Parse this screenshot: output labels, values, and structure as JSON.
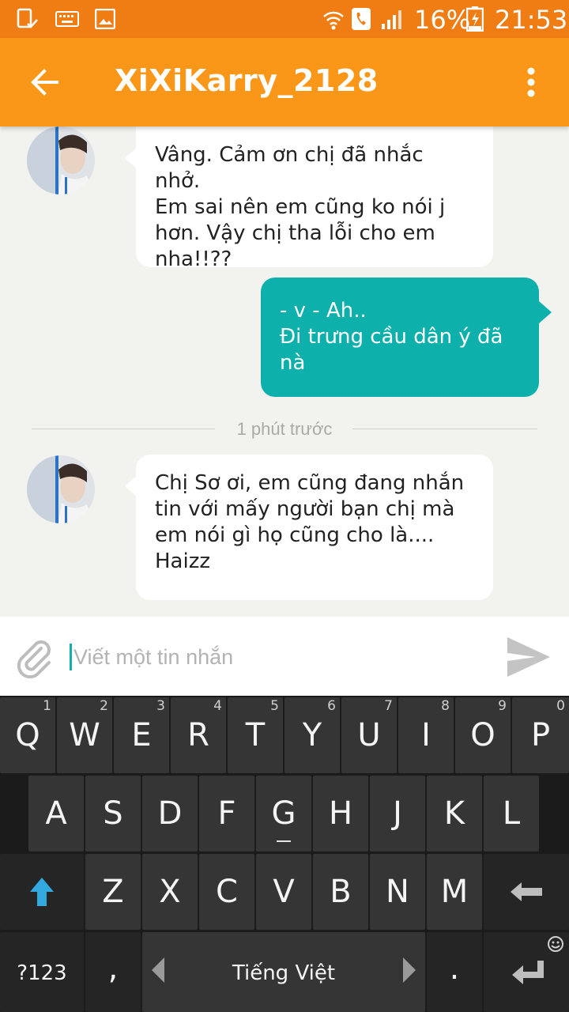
{
  "status_bar": {
    "battery": "16%",
    "time": "21:53"
  },
  "app_bar": {
    "title": "XiXiKarry_2128"
  },
  "messages": [
    {
      "direction": "in",
      "text": "Vâng. Cảm ơn chị đã nhắc nhở.\nEm sai nên em cũng ko nói j\nhơn. Vậy chị tha lỗi cho em\nnha!!??"
    },
    {
      "direction": "out",
      "text": "- v - Ah..\nĐi trưng cầu dân ý đã nà"
    },
    {
      "direction": "in",
      "text": "Chị Sơ ơi, em cũng đang nhắn\ntin với mấy người bạn chị mà\nem nói gì họ cũng cho là....\nHaizz"
    }
  ],
  "time_divider": "1 phút trước",
  "composer": {
    "placeholder": "Viết một tin nhắn"
  },
  "keyboard": {
    "row1": [
      {
        "label": "Q",
        "hint": "1"
      },
      {
        "label": "W",
        "hint": "2"
      },
      {
        "label": "E",
        "hint": "3"
      },
      {
        "label": "R",
        "hint": "4"
      },
      {
        "label": "T",
        "hint": "5"
      },
      {
        "label": "Y",
        "hint": "6"
      },
      {
        "label": "U",
        "hint": "7"
      },
      {
        "label": "I",
        "hint": "8"
      },
      {
        "label": "O",
        "hint": "9"
      },
      {
        "label": "P",
        "hint": "0"
      }
    ],
    "row2": [
      "A",
      "S",
      "D",
      "F",
      "G",
      "H",
      "J",
      "K",
      "L"
    ],
    "row3": [
      "Z",
      "X",
      "C",
      "V",
      "B",
      "N",
      "M"
    ],
    "symbols_label": "?123",
    "comma_label": ",",
    "language_label": "Tiếng Việt",
    "period_label": ".",
    "colors": {
      "status_bar": "#f07c14",
      "app_bar": "#fb9718",
      "outgoing_bubble": "#0eb0ab",
      "shift_arrow": "#33a9e0"
    }
  }
}
